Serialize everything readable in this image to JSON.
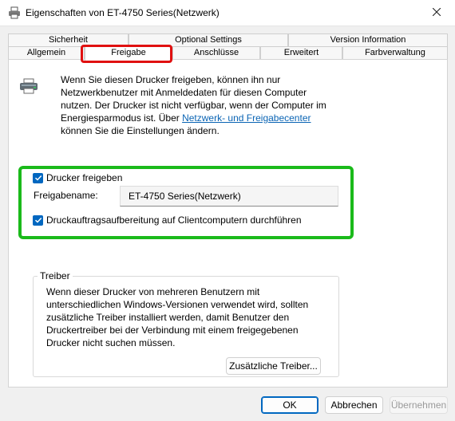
{
  "window": {
    "title": "Eigenschaften von ET-4750 Series(Netzwerk)"
  },
  "tabs": {
    "row1": [
      {
        "label": "Sicherheit"
      },
      {
        "label": "Optional Settings"
      },
      {
        "label": "Version Information"
      }
    ],
    "row2": [
      {
        "label": "Allgemein"
      },
      {
        "label": "Freigabe",
        "active": true
      },
      {
        "label": "Anschlüsse"
      },
      {
        "label": "Erweitert"
      },
      {
        "label": "Farbverwaltung"
      }
    ]
  },
  "info": {
    "text_before_link": "Wenn Sie diesen Drucker freigeben, können ihn nur Netzwerkbenutzer mit Anmeldedaten für diesen Computer nutzen. Der Drucker ist nicht verfügbar, wenn der Computer im Energiesparmodus ist. Über ",
    "link": "Netzwerk- und Freigabecenter",
    "text_after_link": " können Sie die Einstellungen ändern."
  },
  "sharing": {
    "share_printer_label": "Drucker freigeben",
    "share_printer_checked": true,
    "share_name_label": "Freigabename:",
    "share_name_value": "ET-4750 Series(Netzwerk)",
    "render_jobs_label": "Druckauftragsaufbereitung auf Clientcomputern durchführen",
    "render_jobs_checked": true
  },
  "drivers": {
    "group_title": "Treiber",
    "text": "Wenn dieser Drucker von mehreren Benutzern mit unterschiedlichen Windows-Versionen verwendet wird, sollten zusätzliche Treiber installiert werden, damit Benutzer den Druckertreiber bei der Verbindung mit einem freigegebenen Drucker nicht suchen müssen.",
    "additional_drivers_button": "Zusätzliche Treiber..."
  },
  "footer": {
    "ok": "OK",
    "cancel": "Abbrechen",
    "apply": "Übernehmen"
  },
  "colors": {
    "accent": "#0067c0",
    "link": "#0a64b4",
    "highlight_red": "#e01010",
    "highlight_green": "#1aba1a"
  },
  "icons": {
    "title": "printer-icon",
    "close": "close-icon",
    "info": "printer-icon",
    "checkbox": "checkmark-icon"
  }
}
